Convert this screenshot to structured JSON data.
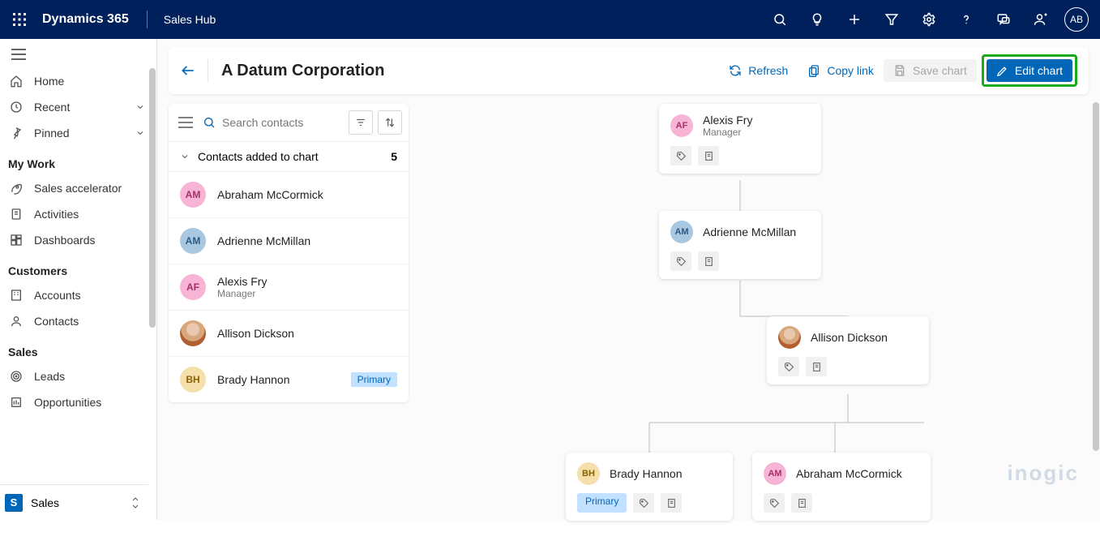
{
  "appbar": {
    "brand": "Dynamics 365",
    "app": "Sales Hub",
    "user_initials": "AB"
  },
  "nav": {
    "home": "Home",
    "recent": "Recent",
    "pinned": "Pinned",
    "sections": {
      "mywork": "My Work",
      "customers": "Customers",
      "sales": "Sales"
    },
    "items": {
      "sales_accelerator": "Sales accelerator",
      "activities": "Activities",
      "dashboards": "Dashboards",
      "accounts": "Accounts",
      "contacts": "Contacts",
      "leads": "Leads",
      "opportunities": "Opportunities"
    },
    "area_switch": {
      "letter": "S",
      "label": "Sales"
    }
  },
  "page": {
    "title": "A Datum Corporation",
    "actions": {
      "refresh": "Refresh",
      "copy_link": "Copy link",
      "save_chart": "Save chart",
      "edit_chart": "Edit chart"
    }
  },
  "panel": {
    "search_placeholder": "Search contacts",
    "group_label": "Contacts added to chart",
    "group_count": "5",
    "primary_tag": "Primary",
    "contacts": [
      {
        "initials": "AM",
        "name": "Abraham McCormick",
        "role": "",
        "avatar": "pink"
      },
      {
        "initials": "AM",
        "name": "Adrienne McMillan",
        "role": "",
        "avatar": "blue"
      },
      {
        "initials": "AF",
        "name": "Alexis Fry",
        "role": "Manager",
        "avatar": "pink"
      },
      {
        "initials": "",
        "name": "Allison Dickson",
        "role": "",
        "avatar": "photo"
      },
      {
        "initials": "BH",
        "name": "Brady Hannon",
        "role": "",
        "avatar": "yellow",
        "primary": true
      }
    ]
  },
  "chart": {
    "primary_tag": "Primary",
    "nodes": {
      "n1": {
        "initials": "AF",
        "name": "Alexis Fry",
        "role": "Manager",
        "avatar": "pink"
      },
      "n2": {
        "initials": "AM",
        "name": "Adrienne McMillan",
        "role": "",
        "avatar": "blue"
      },
      "n3": {
        "initials": "",
        "name": "Allison Dickson",
        "role": "",
        "avatar": "photo"
      },
      "n4": {
        "initials": "BH",
        "name": "Brady Hannon",
        "role": "",
        "avatar": "yellow",
        "primary": true
      },
      "n5": {
        "initials": "AM",
        "name": "Abraham McCormick",
        "role": "",
        "avatar": "pink"
      }
    }
  },
  "watermark": "inogic"
}
